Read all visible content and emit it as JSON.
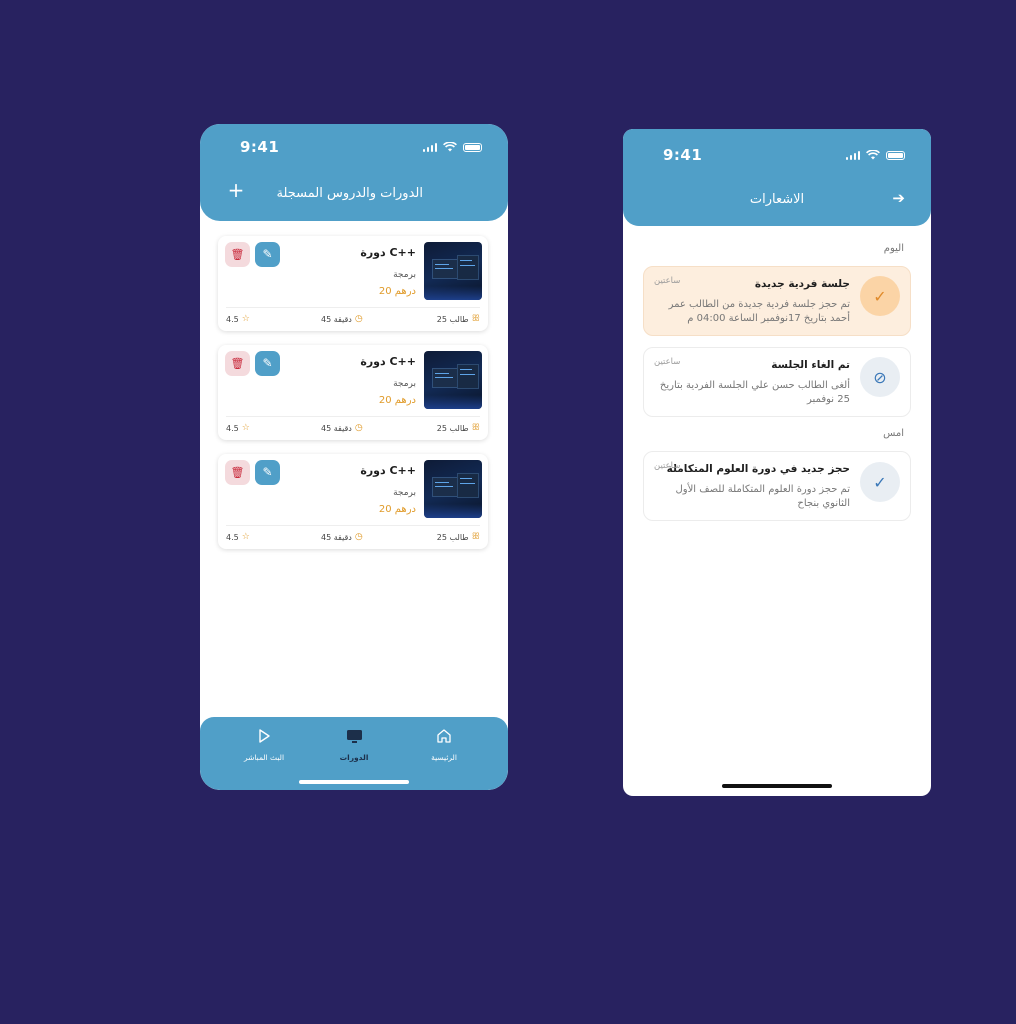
{
  "courses_screen": {
    "status_time": "9:41",
    "title": "الدورات والدروس المسجلة",
    "add_icon": "plus-icon",
    "cards": [
      {
        "title": "دورة C++",
        "category": "برمجة",
        "price": "20 درهم",
        "students": "25 طالب",
        "duration": "45 دقيقة",
        "rating": "4.5"
      },
      {
        "title": "دورة C++",
        "category": "برمجة",
        "price": "20 درهم",
        "students": "25 طالب",
        "duration": "45 دقيقة",
        "rating": "4.5"
      },
      {
        "title": "دورة C++",
        "category": "برمجة",
        "price": "20 درهم",
        "students": "25 طالب",
        "duration": "45 دقيقة",
        "rating": "4.5"
      }
    ],
    "nav": {
      "live": "البث المباشر",
      "courses": "الدورات",
      "home": "الرئيسية"
    }
  },
  "notifications_screen": {
    "status_time": "9:41",
    "title": "الاشعارات",
    "section_today": "اليوم",
    "section_yesterday": "امس",
    "items": [
      {
        "title": "جلسة فردية جديدة",
        "time": "ساعتين",
        "body": "تم حجز جلسة فردية جديدة من الطالب عمر أحمد بتاريخ 17نوفمبر  الساعة 04:00 م",
        "icon": "check-icon"
      },
      {
        "title": "تم الغاء الجلسة",
        "time": "ساعتين",
        "body": "ألغى الطالب حسن علي الجلسة الفردية بتاريخ 25 نوفمبر",
        "icon": "cancel-icon"
      },
      {
        "title": "حجز جديد في دورة العلوم المتكاملة",
        "time": "ساعتين",
        "body": "تم حجز دورة العلوم المتكاملة للصف الأول الثانوي بنجاح",
        "icon": "check-icon"
      }
    ]
  },
  "colors": {
    "primary": "#509fc8",
    "background": "#282260",
    "accent": "#e09b2a",
    "danger": "#c8283a",
    "highlight": "#fdeede"
  }
}
